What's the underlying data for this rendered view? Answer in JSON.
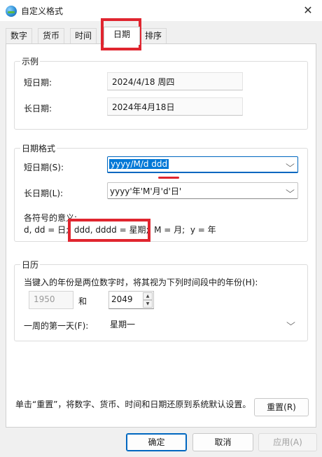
{
  "window": {
    "title": "自定义格式",
    "close_glyph": "✕"
  },
  "tabs": [
    {
      "label": "数字",
      "active": false
    },
    {
      "label": "货币",
      "active": false
    },
    {
      "label": "时间",
      "active": false
    },
    {
      "label": "日期",
      "active": true
    },
    {
      "label": "排序",
      "active": false
    }
  ],
  "example": {
    "legend": "示例",
    "short_label": "短日期:",
    "short_value": "2024/4/18 周四",
    "long_label": "长日期:",
    "long_value": "2024年4月18日"
  },
  "date_format": {
    "legend": "日期格式",
    "short_label": "短日期(S):",
    "short_value": "yyyy/M/d ddd",
    "long_label": "长日期(L):",
    "long_value": "yyyy'年'M'月'd'日'",
    "symbols_title": "各符号的意义:",
    "symbols_text": "d, dd = 日;  ddd, dddd = 星期;  M = 月;  y = 年"
  },
  "calendar": {
    "legend": "日历",
    "two_digit_text": "当键入的年份是两位数字时，将其视为下列时间段中的年份(H):",
    "year_from": "1950",
    "and_label": "和",
    "year_to": "2049",
    "first_day_label": "一周的第一天(F):",
    "first_day_value": "星期一"
  },
  "reset": {
    "description": "单击“重置”，将数字、货币、时间和日期还原到系统默认设置。",
    "button_label": "重置(R)"
  },
  "footer": {
    "ok_label": "确定",
    "cancel_label": "取消",
    "apply_label": "应用(A)"
  },
  "icons": {
    "chevron": "⌵",
    "spin_up": "▲",
    "spin_down": "▼"
  },
  "colors": {
    "accent": "#0067c0",
    "selection": "#0078d7",
    "annotation_red": "#e0252f"
  }
}
